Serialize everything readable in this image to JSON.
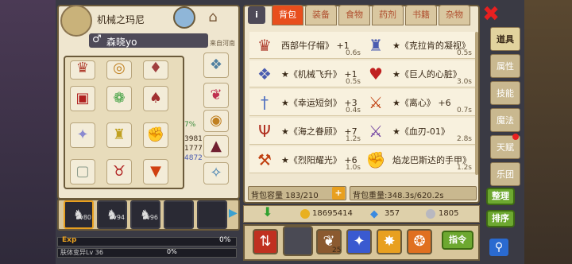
{
  "character": {
    "name": "机械之玛尼",
    "player_name": "森晓yo",
    "region": "来自河南",
    "level_text": "Lv 36",
    "exp_label": "Exp",
    "exp_percent": "0%",
    "sub_exp_label": "肤体变异Lv 36",
    "sub_exp_percent": "0%",
    "party": [
      {
        "label": "Lv80"
      },
      {
        "label": "Lv94"
      },
      {
        "label": "Lv96"
      },
      {
        "label": ""
      },
      {
        "label": ""
      }
    ]
  },
  "inventory": {
    "tabs": [
      "背包",
      "装备",
      "食物",
      "药剂",
      "书籍",
      "杂物"
    ],
    "active_tab": "背包",
    "items": [
      {
        "name": "西部牛仔帽》 +1",
        "weight": "0.6s"
      },
      {
        "name": "★《克拉肯的凝视》",
        "weight": "0.5s"
      },
      {
        "name": "★《机械飞升》 +1",
        "weight": "0.5s"
      },
      {
        "name": "★《巨人的心脏》",
        "weight": "3.0s"
      },
      {
        "name": "★《幸运短剑》 +3",
        "weight": "0.4s"
      },
      {
        "name": "★《离心》 +6",
        "weight": "0.7s"
      },
      {
        "name": "★《海之眷顾》 +7",
        "weight": "1.2s"
      },
      {
        "name": "★《血刃-01》",
        "weight": "2.8s"
      },
      {
        "name": "★《烈阳耀光》 +6",
        "weight": "1.0s"
      },
      {
        "name": "焰龙巴斯达的手甲》",
        "weight": "1.2s"
      }
    ],
    "capacity_label": "背包容量 183/210",
    "weight_label": "背包重量:348.3s/620.2s",
    "sort_label": "整理",
    "arrange_label": "排序"
  },
  "currency": {
    "gold": "18695414",
    "gems": "357",
    "silver": "1805"
  },
  "side_tabs": [
    {
      "label": "道具",
      "active": true
    },
    {
      "label": "属性",
      "active": false
    },
    {
      "label": "技能",
      "active": false
    },
    {
      "label": "魔法",
      "active": false
    },
    {
      "label": "天赋",
      "active": false
    },
    {
      "label": "乐团",
      "active": false
    }
  ],
  "actions": {
    "command_label": "指令",
    "skill_badge": "25"
  },
  "partial_stats": [
    "3981",
    "1777",
    "4872",
    "7%"
  ],
  "colors": {
    "accent_red": "#e84e1d",
    "parchment": "#efe6cf",
    "green_button": "#6da830"
  }
}
